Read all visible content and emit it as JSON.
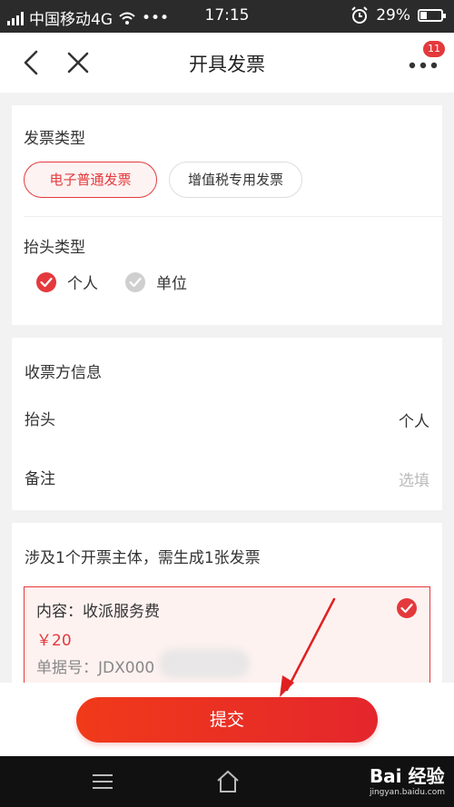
{
  "status": {
    "carrier": "中国移动4G",
    "more": "•••",
    "time": "17:15",
    "battery": "29%"
  },
  "nav": {
    "title": "开具发票",
    "badge": "11"
  },
  "invoice_type": {
    "label": "发票类型",
    "options": [
      "电子普通发票",
      "增值税专用发票"
    ]
  },
  "header_type": {
    "label": "抬头类型",
    "options": [
      "个人",
      "单位"
    ]
  },
  "receiver": {
    "label": "收票方信息",
    "title_label": "抬头",
    "title_value": "个人",
    "remark_label": "备注",
    "remark_placeholder": "选填"
  },
  "summary": {
    "text": "涉及1个开票主体，需生成1张发票",
    "content": "内容：收派服务费",
    "amount": "￥20",
    "doc_no": "单据号：JDX000"
  },
  "actions": {
    "submit": "提交"
  },
  "watermark": {
    "logo": "Bai 经验",
    "url": "jingyan.baidu.com"
  },
  "colors": {
    "accent": "#e4393c"
  }
}
